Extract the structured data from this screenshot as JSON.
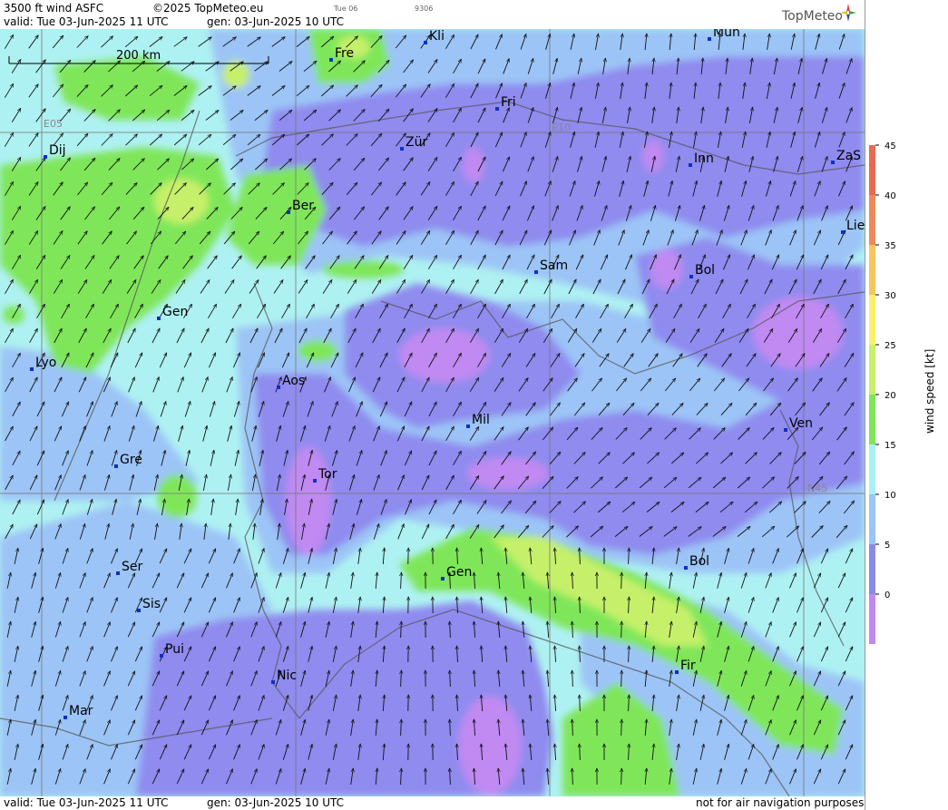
{
  "header": {
    "product": "3500 ft wind ASFC",
    "copyright": "©2025 TopMeteo.eu",
    "tiny_day": "Tue 06",
    "tiny_code": "9306",
    "valid": "valid:  Tue   03-Jun-2025  11 UTC",
    "gen": "gen: 03-Jun-2025 10 UTC",
    "logo_text": "TopMeteo"
  },
  "footer": {
    "valid": "valid:  Tue   03-Jun-2025  11 UTC",
    "gen": "gen: 03-Jun-2025 10 UTC",
    "disclaimer": "not for air navigation purposes"
  },
  "map": {
    "scale_label": "200 km",
    "grid_labels": {
      "e05": "E05",
      "e10": "E10",
      "n45": "N45"
    },
    "cities": [
      {
        "name": "Fre"
      },
      {
        "name": "Kli"
      },
      {
        "name": "Mün"
      },
      {
        "name": "Fri"
      },
      {
        "name": "Dij"
      },
      {
        "name": "Zür"
      },
      {
        "name": "Inn"
      },
      {
        "name": "ZaS"
      },
      {
        "name": "Ber"
      },
      {
        "name": "Lie"
      },
      {
        "name": "Sam"
      },
      {
        "name": "Bol"
      },
      {
        "name": "Gen"
      },
      {
        "name": "Lyo"
      },
      {
        "name": "Aos"
      },
      {
        "name": "Mil"
      },
      {
        "name": "Ven"
      },
      {
        "name": "Gre"
      },
      {
        "name": "Tor"
      },
      {
        "name": "Ser"
      },
      {
        "name": "Gen"
      },
      {
        "name": "Bol"
      },
      {
        "name": "Sis"
      },
      {
        "name": "Pui"
      },
      {
        "name": "Nic"
      },
      {
        "name": "Fir"
      },
      {
        "name": "Mar"
      }
    ]
  },
  "legend": {
    "title": "wind speed [kt]",
    "ticks": [
      "45",
      "40",
      "35",
      "30",
      "25",
      "20",
      "15",
      "10",
      "5",
      "0"
    ],
    "colors": [
      "#e86a50",
      "#ee8a5a",
      "#f6c560",
      "#f9f06a",
      "#c8f068",
      "#7fe65a",
      "#aaf2f2",
      "#9cc4f6",
      "#8a8ae6",
      "#c08af2"
    ]
  },
  "colors": {
    "calm_violet": "#c08af2",
    "low_purple": "#8f8bef",
    "mid_blue": "#9cc4f6",
    "cyan": "#aef1f2",
    "green": "#7fe65a",
    "yellow_green": "#c6f06a"
  }
}
